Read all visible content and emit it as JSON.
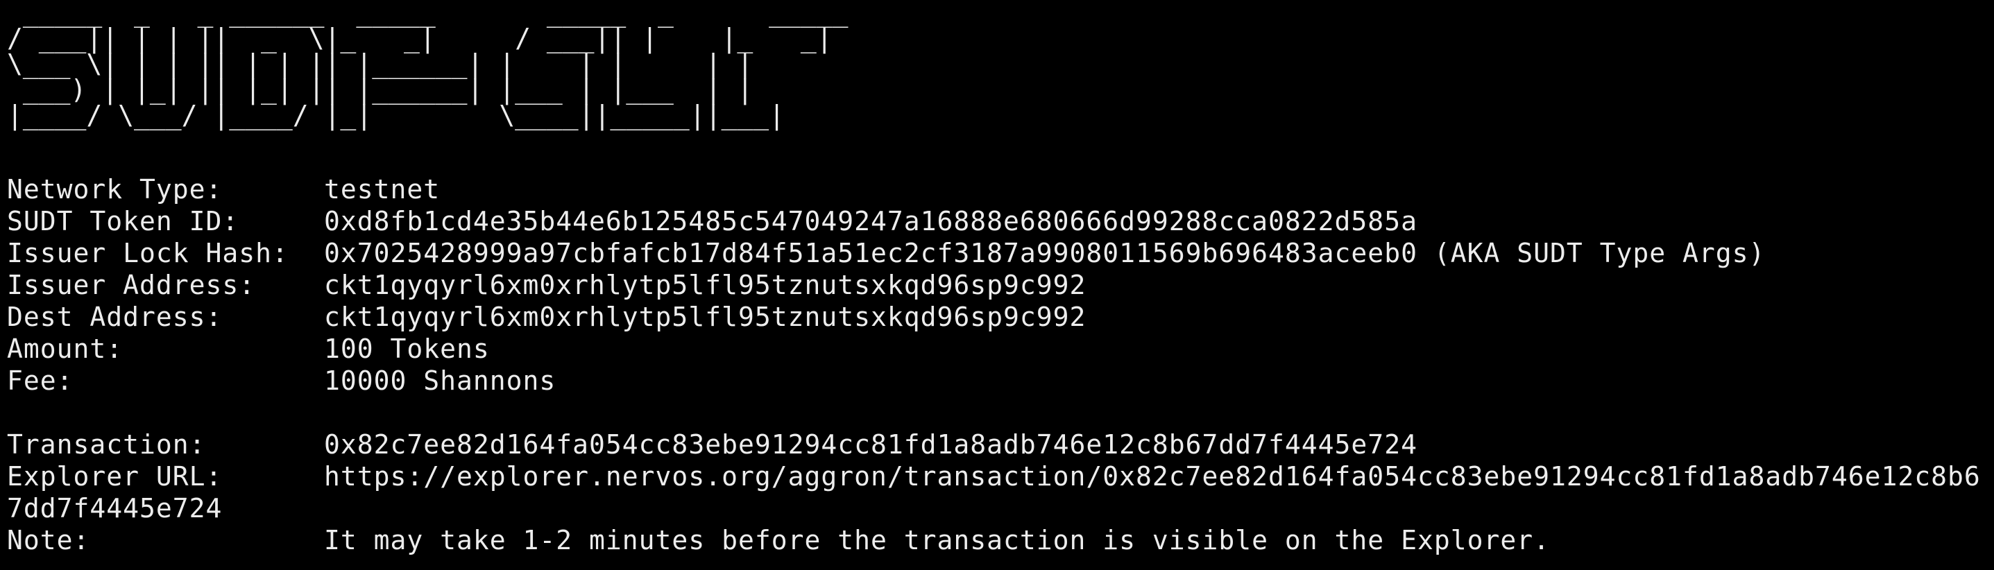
{
  "banner": " _____  _   _ ______  _____       _____  _      _____\n/ ___|| | | ||  _  \\|_   _|     / ___|| |    |_   _|\n\\___ \\| | | || | | || |______| |    | |     | |\n ___) | |_| || |_| || |______| |___ | |___  | |\n|____/ \\___/ |____/ |_|        \\____||_____||___|",
  "fields": [
    {
      "label": "Network Type:",
      "value": "testnet"
    },
    {
      "label": "SUDT Token ID:",
      "value": "0xd8fb1cd4e35b44e6b125485c547049247a16888e680666d99288cca0822d585a"
    },
    {
      "label": "Issuer Lock Hash:",
      "value": "0x7025428999a97cbfafcb17d84f51a51ec2cf3187a9908011569b696483aceeb0 (AKA SUDT Type Args)"
    },
    {
      "label": "Issuer Address:",
      "value": "ckt1qyqyrl6xm0xrhlytp5lfl95tznutsxkqd96sp9c992"
    },
    {
      "label": "Dest Address:",
      "value": "ckt1qyqyrl6xm0xrhlytp5lfl95tznutsxkqd96sp9c992"
    },
    {
      "label": "Amount:",
      "value": "100 Tokens"
    },
    {
      "label": "Fee:",
      "value": "10000 Shannons"
    }
  ],
  "transaction": {
    "label": "Transaction:",
    "value": "0x82c7ee82d164fa054cc83ebe91294cc81fd1a8adb746e12c8b67dd7f4445e724"
  },
  "explorer": {
    "label": "Explorer URL:",
    "value_line1": "https://explorer.nervos.org/aggron/transaction/0x82c7ee82d164fa054cc83ebe91294cc81fd1a8adb746e12c8b6",
    "value_line2": "7dd7f4445e724"
  },
  "note": {
    "label": "Note:",
    "value": "It may take 1-2 minutes before the transaction is visible on the Explorer."
  }
}
